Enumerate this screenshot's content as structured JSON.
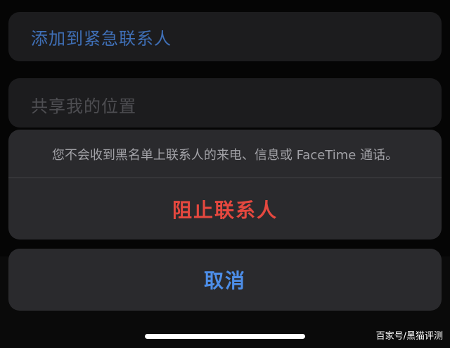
{
  "background": {
    "add_emergency_contact": "添加到紧急联系人",
    "share_location": "共享我的位置"
  },
  "action_sheet": {
    "message": "您不会收到黑名单上联系人的来电、信息或 FaceTime 通话。",
    "block_label": "阻止联系人",
    "cancel_label": "取消"
  },
  "watermark": "百家号/黑猫评测",
  "colors": {
    "destructive": "#e5483f",
    "accent": "#4d8ee8",
    "sheet_bg": "#2a2a2d",
    "row_bg": "#1c1c1e"
  }
}
